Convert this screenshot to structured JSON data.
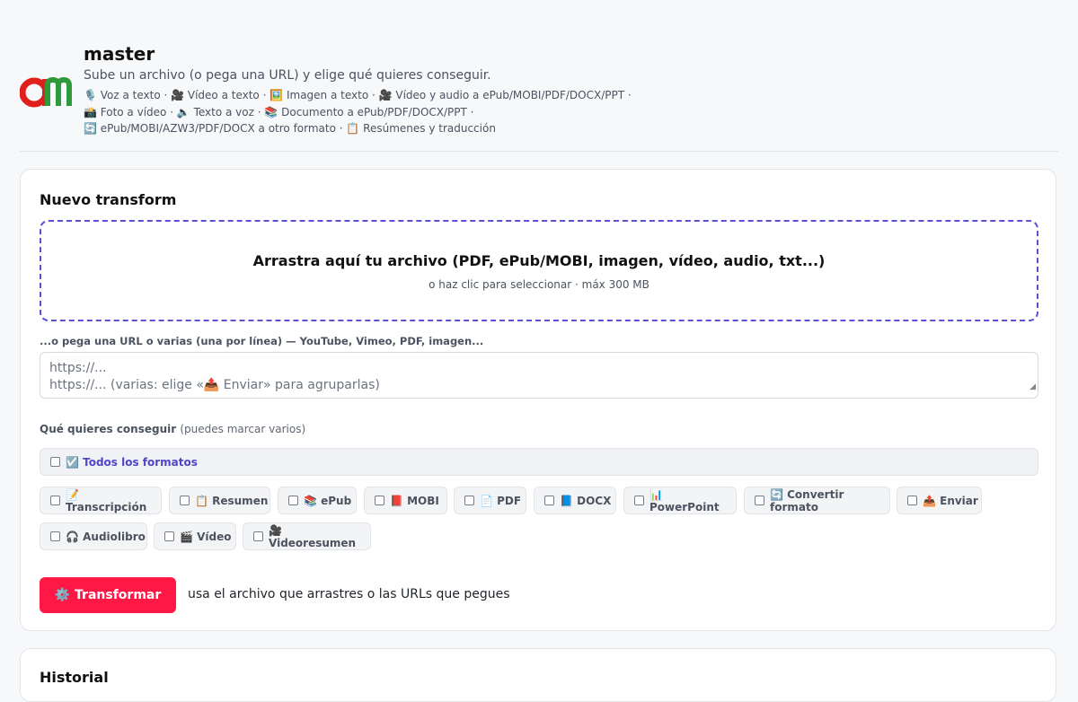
{
  "header": {
    "title": "master",
    "subtitle": "Sube un archivo (o pega una URL) y elige qué quieres conseguir.",
    "features": [
      "🎙️ Voz a texto · 🎥 Vídeo a texto · 🖼️ Imagen a texto · 🎥 Vídeo y audio a ePub/MOBI/PDF/DOCX/PPT ·",
      "📸 Foto a vídeo · 🔈 Texto a voz · 📚 Documento a ePub/PDF/DOCX/PPT ·",
      "🔄 ePub/MOBI/AZW3/PDF/DOCX a otro formato · 📋 Resúmenes y traducción"
    ]
  },
  "card": {
    "title": "Nuevo transform",
    "dropzone": {
      "main": "Arrastra aquí tu archivo (PDF, ePub/MOBI, imagen, vídeo, audio, txt...)",
      "sub": "o haz clic para seleccionar · máx 300 MB"
    },
    "url_label": "...o pega una URL o varias (una por línea) — YouTube, Vimeo, PDF, imagen...",
    "url_placeholder_1": "https://...",
    "url_placeholder_2": "https://... (varias: elige «📤 Enviar» para agruparlas)",
    "goal_label": "Qué quieres conseguir",
    "goal_hint": "(puedes marcar varios)",
    "all_formats": "☑️ Todos los formatos",
    "options": [
      "📝 Transcripción",
      "📋 Resumen",
      "📚 ePub",
      "📕 MOBI",
      "📄 PDF",
      "📘 DOCX",
      "📊 PowerPoint",
      "🔄 Convertir formato",
      "📤 Enviar",
      "🎧 Audiolibro",
      "🎬 Vídeo",
      "🎥 Videoresumen"
    ],
    "transform_button": "⚙️ Transformar",
    "transform_hint": "usa el archivo que arrastres o las URLs que pegues"
  },
  "card2": {
    "title": "Historial"
  },
  "colors": {
    "accent": "#5b4fd6",
    "primary": "#ff1745"
  }
}
